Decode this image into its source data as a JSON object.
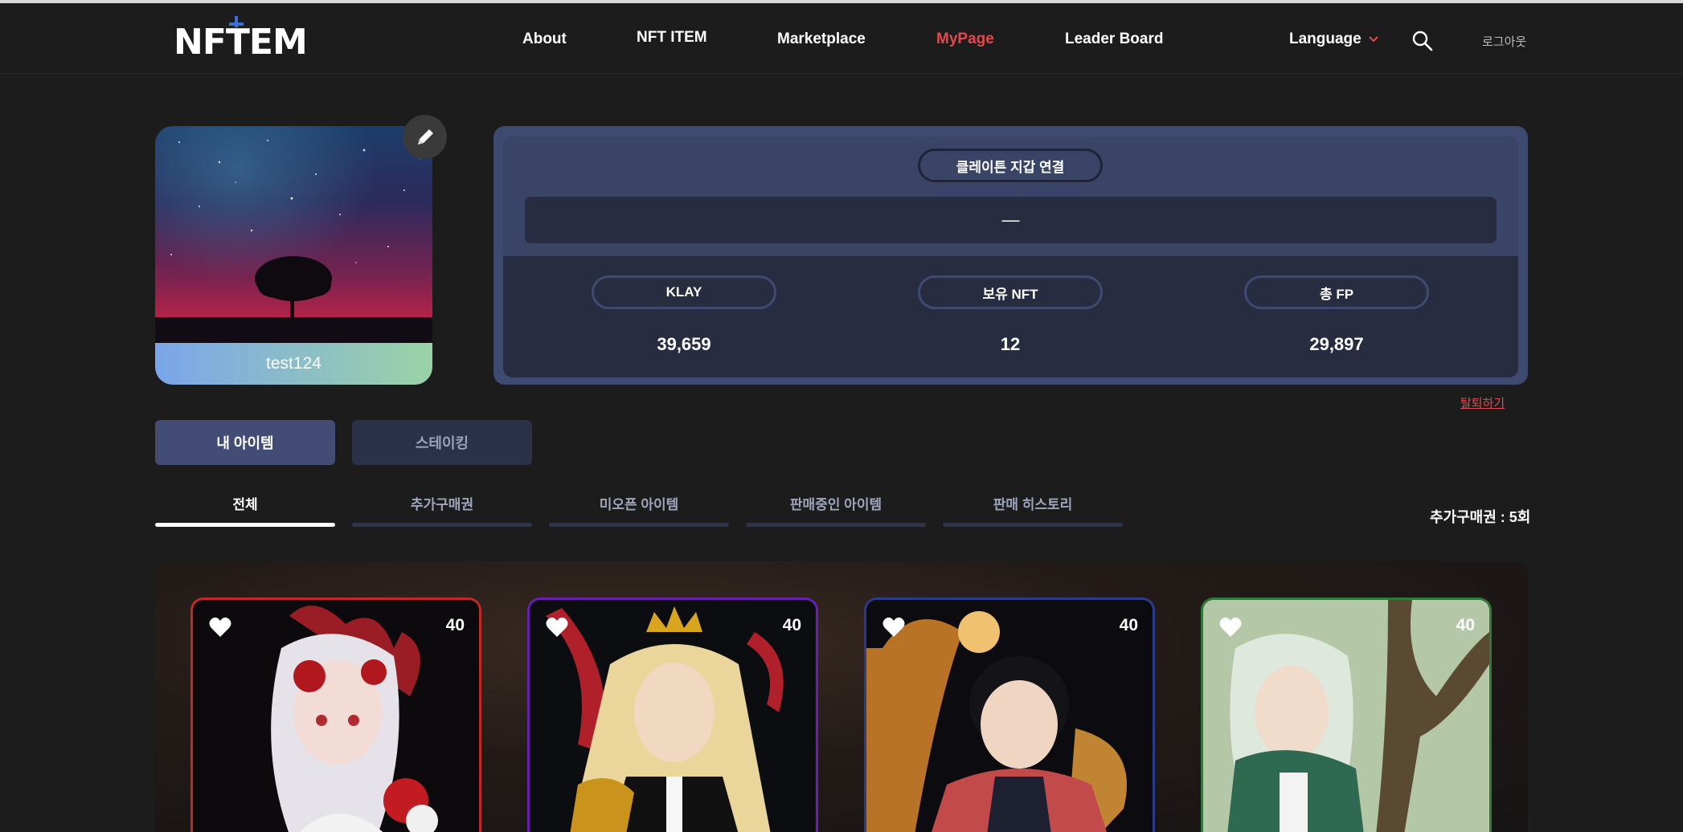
{
  "header": {
    "logo_text": "NFTEM",
    "nav": [
      {
        "label": "About"
      },
      {
        "label": "NFT ITEM"
      },
      {
        "label": "Marketplace"
      },
      {
        "label": "MyPage"
      },
      {
        "label": "Leader Board"
      }
    ],
    "active_nav": "MyPage",
    "language_label": "Language",
    "logout_label": "로그아웃",
    "accent_color": "#e5484d"
  },
  "profile": {
    "username": "test124",
    "edit_icon": "pencil-icon"
  },
  "wallet": {
    "connect_label": "클레이튼 지갑 연결",
    "address": "—",
    "stats": [
      {
        "label": "KLAY",
        "value": "39,659"
      },
      {
        "label": "보유 NFT",
        "value": "12"
      },
      {
        "label": "총 FP",
        "value": "29,897"
      }
    ]
  },
  "withdraw_label": "탈퇴하기",
  "main_tabs": [
    {
      "label": "내 아이템",
      "active": true
    },
    {
      "label": "스테이킹",
      "active": false
    }
  ],
  "sub_tabs": [
    {
      "label": "전체",
      "active": true
    },
    {
      "label": "추가구매권",
      "active": false
    },
    {
      "label": "미오픈 아이템",
      "active": false
    },
    {
      "label": "판매중인 아이템",
      "active": false
    },
    {
      "label": "판매 히스토리",
      "active": false
    }
  ],
  "purchase_count_text": "추가구매권 : 5회",
  "items": [
    {
      "count": "40",
      "border_color": "#c0282a",
      "icon": "heart-icon"
    },
    {
      "count": "40",
      "border_color": "#6a1fb0",
      "icon": "heart-icon"
    },
    {
      "count": "40",
      "border_color": "#2a3a8c",
      "icon": "heart-icon"
    },
    {
      "count": "40",
      "border_color": "#2f7a3a",
      "icon": "heart-icon"
    }
  ]
}
